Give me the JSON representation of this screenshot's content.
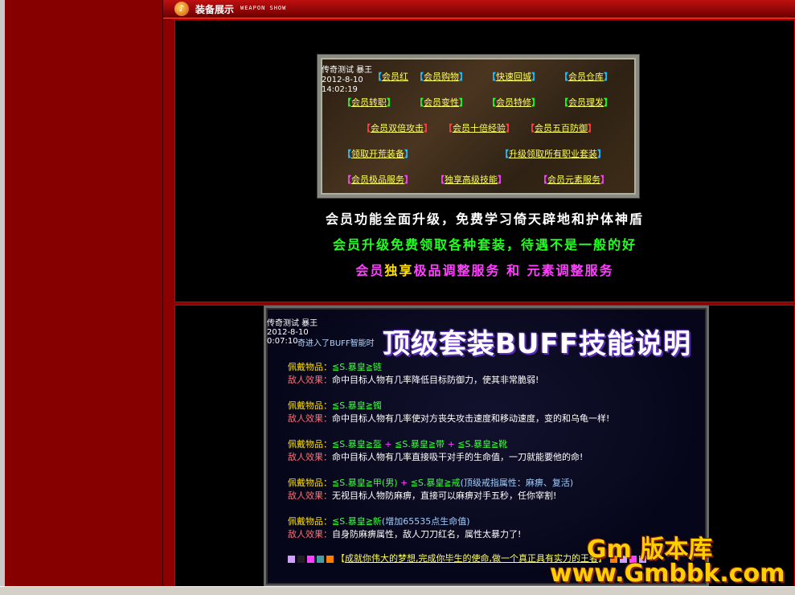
{
  "header": {
    "title": "装备展示",
    "subtitle": "WEAPON SHOW",
    "icon": "speaker-icon"
  },
  "panel1": {
    "timestamp": [
      "传奇测试 暴王",
      "2012-8-10",
      "14:02:19"
    ],
    "menu": [
      {
        "text": "会员红",
        "color": "#ffff60"
      },
      {
        "text": "会员购物",
        "color": "#ffff60"
      },
      {
        "text": "快速回城",
        "color": "#ffff60"
      },
      {
        "text": "会员仓库",
        "color": "#ffff60"
      },
      {
        "text": "会员转职",
        "color": "#ffff60"
      },
      {
        "text": "会员变性",
        "color": "#ffff60"
      },
      {
        "text": "会员特修",
        "color": "#ffff60"
      },
      {
        "text": "会员理发",
        "color": "#ffff60"
      },
      {
        "text": "会员双倍攻击",
        "color": "#ffff60"
      },
      {
        "text": "会员十倍经验",
        "color": "#ffff60"
      },
      {
        "text": "会员五百防御",
        "color": "#ffff60"
      },
      {
        "text": "领取开荒装备",
        "color": "#ffff60"
      },
      {
        "text": "升级领取所有职业套装",
        "color": "#ffff60"
      },
      {
        "text": "会员极品服务",
        "color": "#ffff60"
      },
      {
        "text": "独享高级技能",
        "color": "#ffff60"
      },
      {
        "text": "会员元素服务",
        "color": "#ffff60"
      }
    ],
    "slogans": {
      "line1": "会员功能全面升级，免费学习倚天辟地和护体神盾",
      "line2": "会员升级免费领取各种套装，待遇不是一般的好",
      "line3_a": "会员",
      "line3_b": "独享",
      "line3_c": "极品调整服务 和 元素调整服务"
    }
  },
  "panel2": {
    "timestamp": [
      "传奇测试 暴王",
      "2012-8-10",
      "0:07:10"
    ],
    "intro": "奇进入了BUFF智能时",
    "title": "顶级套装BUFF技能说明",
    "labels": {
      "wear": "佩戴物品：",
      "effect": "敌人效果："
    },
    "rows": [
      {
        "items": [
          "≦S.暴皇≧链"
        ],
        "note": "",
        "effect": "命中目标人物有几率降低目标防御力，使其非常脆弱!"
      },
      {
        "items": [
          "≦S.暴皇≧镯"
        ],
        "note": "",
        "effect": "命中目标人物有几率使对方丧失攻击速度和移动速度，变的和乌龟一样!"
      },
      {
        "items": [
          "≦S.暴皇≧盔",
          "≦S.暴皇≧带",
          "≦S.暴皇≧靴"
        ],
        "note": "",
        "effect": "命中目标人物有几率直接吸干对手的生命值，一刀就能要他的命!"
      },
      {
        "items": [
          "≦S.暴皇≧甲(男)",
          "≦S.暴皇≧戒"
        ],
        "note": "(顶级戒指属性：麻痹、复活)",
        "effect": "无视目标人物防麻痹，直接可以麻痹对手五秒，任你宰割!"
      },
      {
        "items": [
          "≦S.暴皇≧新"
        ],
        "note": "(增加65535点生命值)",
        "effect": "自身防麻痹属性，敌人刀刀红名，属性太暴力了!"
      }
    ],
    "plus": "+",
    "motto_open": "【",
    "motto": "成就你伟大的梦想,完成你毕生的使命,做一个真正具有实力的王者",
    "motto_close": "】",
    "squares_left": [
      "#d0a0ff",
      "#202020",
      "#ff40ff",
      "#40a0a0",
      "#ff8000"
    ],
    "squares_right": [
      "#ff8000",
      "#d0a0ff",
      "#ff40ff",
      "#d0a0ff"
    ]
  },
  "watermark": {
    "line1": "Gm 版本库",
    "line2": "www.Gmbbk.com"
  },
  "colors": {
    "bracket_cyan": "#20c0ff",
    "bracket_green": "#20ff20",
    "bracket_red": "#ff4040",
    "bracket_magenta": "#ff40ff",
    "slogan_white": "#ffffff",
    "slogan_green": "#20ff20",
    "slogan_magenta": "#ff40ff",
    "slogan_yellow": "#ffe000"
  }
}
